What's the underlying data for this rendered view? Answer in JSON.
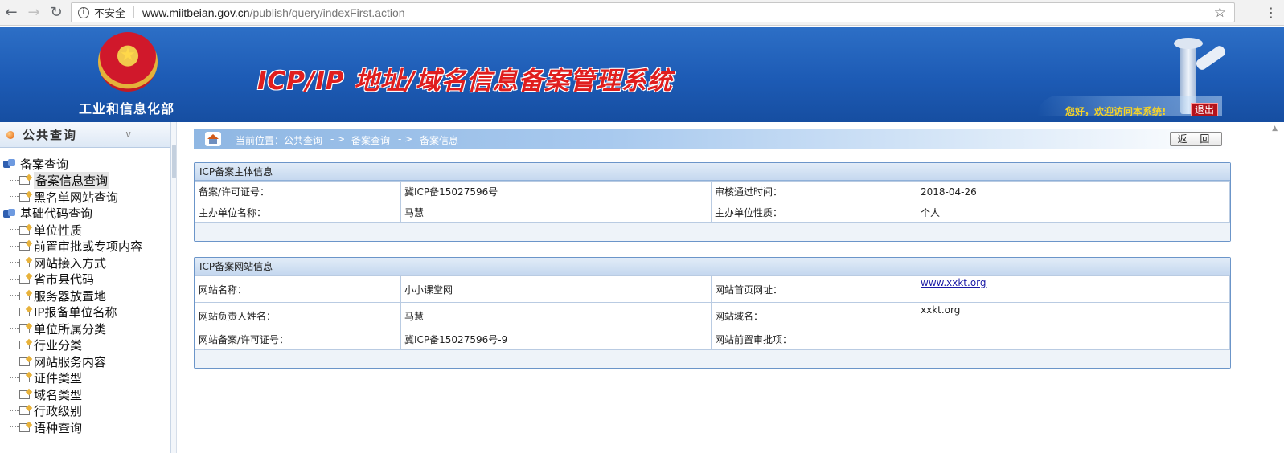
{
  "browser": {
    "insecure_label": "不安全",
    "url_host": "www.miitbeian.gov.cn",
    "url_path": "/publish/query/indexFirst.action"
  },
  "header": {
    "ministry": "工业和信息化部",
    "system_title": "ICP/IP 地址/域名信息备案管理系统",
    "welcome": "您好，欢迎访问本系统!",
    "logout": "退出"
  },
  "sidebar": {
    "title": "公共查询",
    "groups": [
      {
        "label": "备案查询",
        "items": [
          "备案信息查询",
          "黑名单网站查询"
        ]
      },
      {
        "label": "基础代码查询",
        "items": [
          "单位性质",
          "前置审批或专项内容",
          "网站接入方式",
          "省市县代码",
          "服务器放置地",
          "IP报备单位名称",
          "单位所属分类",
          "行业分类",
          "网站服务内容",
          "证件类型",
          "域名类型",
          "行政级别",
          "语种查询"
        ]
      }
    ]
  },
  "breadcrumb": {
    "current": "当前位置：公共查询",
    "sep1": "- >",
    "level2": "备案查询",
    "sep2": "- >",
    "level3": "备案信息"
  },
  "back_button": "返 回",
  "subject_panel": {
    "title": "ICP备案主体信息",
    "rows": [
      [
        "备案/许可证号：",
        "冀ICP备15027596号",
        "审核通过时间：",
        "2018-04-26"
      ],
      [
        "主办单位名称：",
        "马慧",
        "主办单位性质：",
        "个人"
      ]
    ]
  },
  "website_panel": {
    "title": "ICP备案网站信息",
    "rows": [
      [
        "网站名称：",
        "小小课堂网",
        "网站首页网址：",
        "www.xxkt.org"
      ],
      [
        "网站负责人姓名：",
        "马慧",
        "网站域名：",
        "xxkt.org"
      ],
      [
        "网站备案/许可证号：",
        "冀ICP备15027596号-9",
        "网站前置审批项：",
        ""
      ]
    ]
  }
}
